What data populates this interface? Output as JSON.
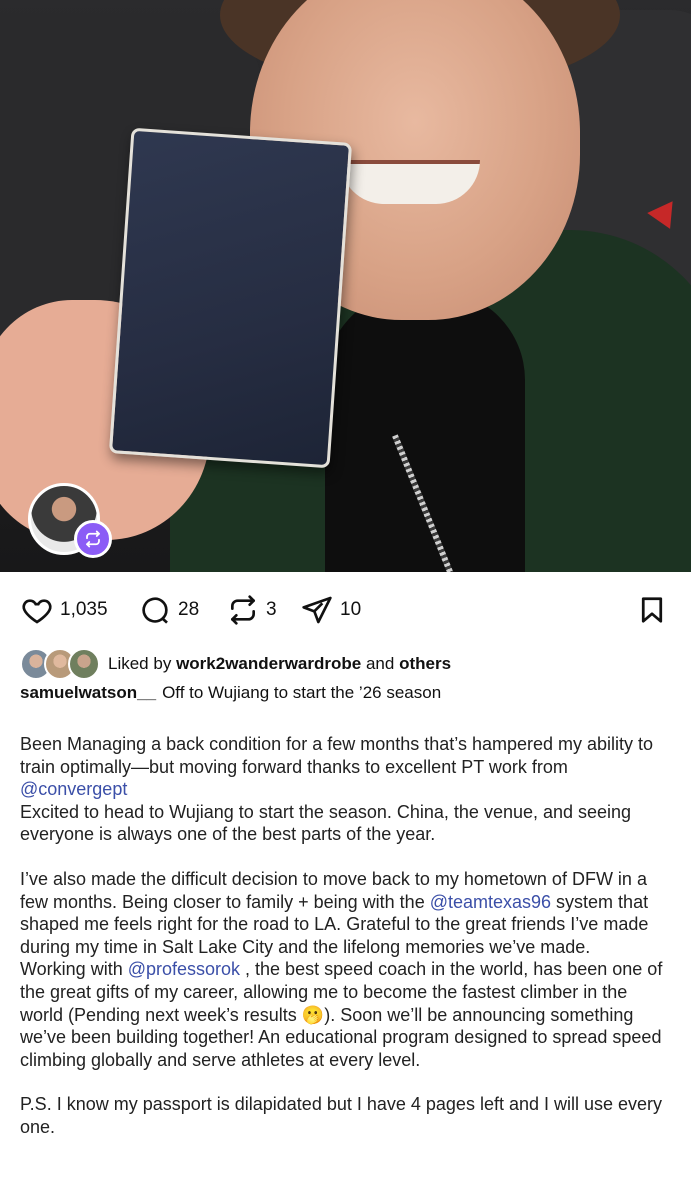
{
  "post": {
    "stats": {
      "likes": "1,035",
      "comments": "28",
      "reposts": "3",
      "shares": "10"
    },
    "liked_by": {
      "prefix": "Liked by",
      "user": "work2wanderwardrobe",
      "joiner": "and",
      "others": "others"
    },
    "caption": {
      "username": "samuelwatson__",
      "headline": "Off to Wujiang to start the ’26 season"
    },
    "body": {
      "p1_a": "Been Managing a back condition for a few months that’s hampered my ability to train optimally—but moving forward thanks to excellent PT work from ",
      "p1_mention": "@convergept",
      "p2": "Excited to head to Wujiang to start the season. China, the venue, and seeing everyone is always one of the best parts of the year.",
      "p3_a": "I’ve also made the difficult decision to move back to my hometown of DFW in a few months. Being closer to family + being with the ",
      "p3_mention": "@teamtexas96",
      "p3_b": " system that shaped me feels right for the road to LA. Grateful to the great friends I’ve made during my time in Salt Lake City and the lifelong memories we’ve made.",
      "p4_a": "Working with ",
      "p4_mention": "@professorok",
      "p4_b": " , the best speed coach in the world, has been one of the great gifts of my career, allowing me to become the fastest climber in the world (Pending next week’s results ",
      "p4_emoji": "🫢",
      "p4_c": "). Soon we’ll be announcing something we’ve been building together! An educational program designed to spread speed climbing globally and serve athletes at every level.",
      "p5": "P.S. I know my passport is dilapidated but I have 4 pages left and I will use every one."
    },
    "icons": [
      "heart-icon",
      "comment-icon",
      "repost-icon",
      "share-icon",
      "bookmark-icon",
      "collab-icon"
    ],
    "colors": {
      "mention": "#3b4fa8",
      "collab_badge": "#8b5cf6"
    }
  }
}
